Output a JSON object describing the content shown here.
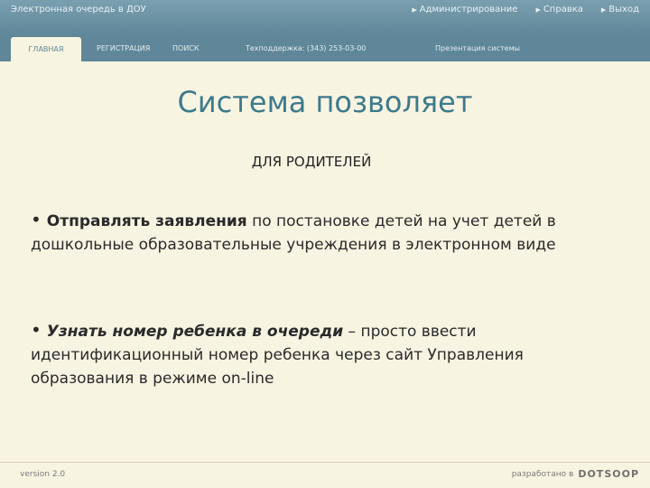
{
  "header": {
    "app_title": "Электронная очередь в ДОУ",
    "links": [
      {
        "label": "Администрирование"
      },
      {
        "label": "Справка"
      },
      {
        "label": "Выход"
      }
    ]
  },
  "tabs": {
    "home": "ГЛАВНАЯ",
    "registration": "РЕГИСТРАЦИЯ",
    "search": "ПОИСК",
    "support": "Техподдержка: (343) 253-03-00",
    "presentation": "Презентация системы"
  },
  "slide": {
    "title": "Система позволяет",
    "subtitle": "ДЛЯ РОДИТЕЛЕЙ",
    "bullets": [
      {
        "bold": "Отправлять заявления",
        "text": " по постановке детей на учет детей в дошкольные образовательные учреждения в электронном виде"
      },
      {
        "bold": "Узнать номер ребенка в очереди",
        "text": " – просто ввести идентификационный номер ребенка через сайт Управления образования в режиме on-line"
      }
    ]
  },
  "footer": {
    "version": "version 2.0",
    "developer_label": "разработано в",
    "developer_logo": "DOTSOOP"
  }
}
